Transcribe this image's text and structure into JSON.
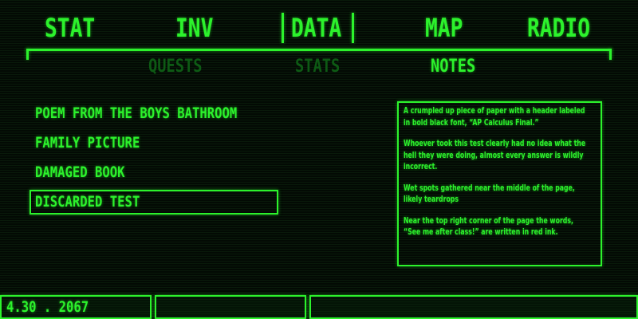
{
  "main_tabs": [
    {
      "label": "STAT"
    },
    {
      "label": "INV"
    },
    {
      "label": "DATA"
    },
    {
      "label": "MAP"
    },
    {
      "label": "RADIO"
    }
  ],
  "active_main_tab": "DATA",
  "sub_tabs": [
    {
      "label": "QUESTS",
      "state": "dim"
    },
    {
      "label": "STATS",
      "state": "dim"
    },
    {
      "label": "NOTES",
      "state": "active"
    }
  ],
  "notes": {
    "items": [
      {
        "label": "POEM FROM THE BOYS BATHROOM"
      },
      {
        "label": "FAMILY PICTURE"
      },
      {
        "label": "DAMAGED BOOK"
      },
      {
        "label": "DISCARDED TEST"
      }
    ],
    "selected": "DISCARDED TEST",
    "detail_paragraphs": [
      "A crumpled up piece of paper with a header labeled in bold black font, “AP Calculus Final.”",
      "Whoever took this test clearly had no idea what the hell they were doing, almost every answer is wildly incorrect.",
      "Wet spots gathered near the middle of the page, likely teardrops",
      "Near the top right corner of the page the words, “See me after class!” are written in red ink."
    ]
  },
  "status_bar": {
    "date": "4.30 . 2067"
  },
  "colors": {
    "phosphor_green": "#2cf22c",
    "dim_green": "#0d5a14",
    "background": "#030a04"
  }
}
